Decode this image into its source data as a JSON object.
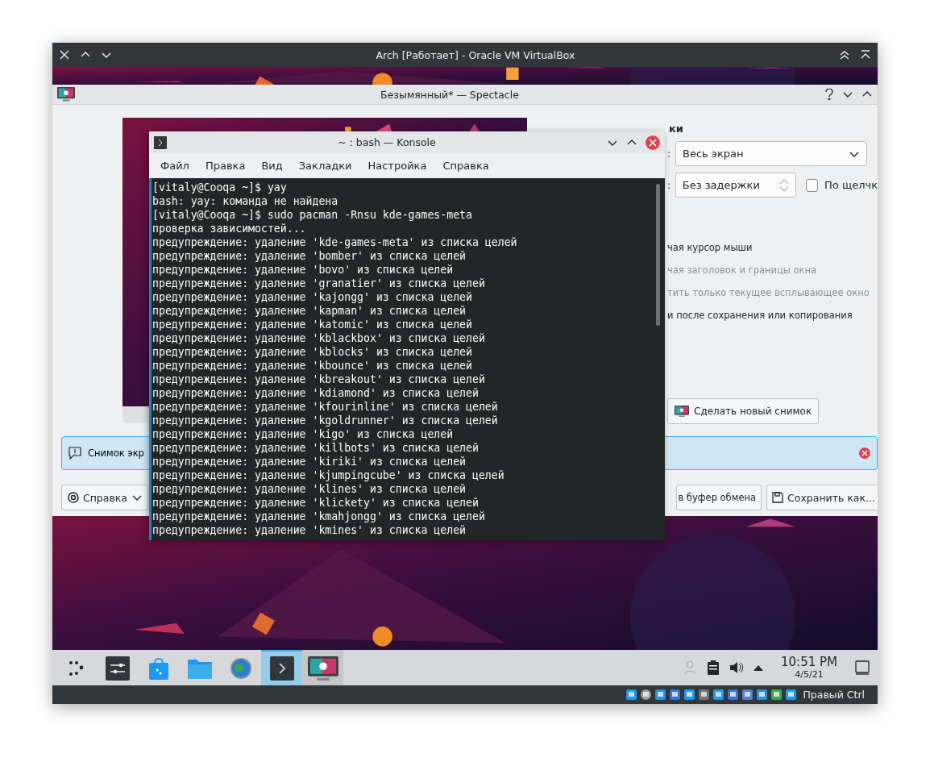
{
  "window": {
    "title": "Arch [Работает] - Oracle VM VirtualBox"
  },
  "spectacle": {
    "title": "Безымянный* — Spectacle",
    "heading": "ки",
    "area_label": ":",
    "area": "Весь экран",
    "delay_label": ":",
    "delay": "Без задержки",
    "on_click": {
      "label": "По щелчк",
      "checked": false
    },
    "options": [
      {
        "label": "чая курсор мыши",
        "disabled": false
      },
      {
        "label": "чая заголовок и границы окна",
        "disabled": true
      },
      {
        "label": "тить только текущее всплывающее окно",
        "disabled": true
      },
      {
        "label": "и после сохранения или копирования",
        "disabled": false
      }
    ],
    "new_button": "Сделать новый снимок",
    "banner": {
      "text": "Снимок экр"
    },
    "help_button": "Справка",
    "copy_button": "в буфер обмена",
    "save_button": "Сохранить как..."
  },
  "konsole": {
    "title": "~ : bash — Konsole",
    "menu": [
      "Файл",
      "Правка",
      "Вид",
      "Закладки",
      "Настройка",
      "Справка"
    ],
    "lines": [
      "[vitaly@Cooqa ~]$ yay",
      "bash: yay: команда не найдена",
      "[vitaly@Cooqa ~]$ sudo pacman -Rnsu kde-games-meta",
      "проверка зависимостей...",
      "предупреждение: удаление 'kde-games-meta' из списка целей",
      "предупреждение: удаление 'bomber' из списка целей",
      "предупреждение: удаление 'bovo' из списка целей",
      "предупреждение: удаление 'granatier' из списка целей",
      "предупреждение: удаление 'kajongg' из списка целей",
      "предупреждение: удаление 'kapman' из списка целей",
      "предупреждение: удаление 'katomic' из списка целей",
      "предупреждение: удаление 'kblackbox' из списка целей",
      "предупреждение: удаление 'kblocks' из списка целей",
      "предупреждение: удаление 'kbounce' из списка целей",
      "предупреждение: удаление 'kbreakout' из списка целей",
      "предупреждение: удаление 'kdiamond' из списка целей",
      "предупреждение: удаление 'kfourinline' из списка целей",
      "предупреждение: удаление 'kgoldrunner' из списка целей",
      "предупреждение: удаление 'kigo' из списка целей",
      "предупреждение: удаление 'killbots' из списка целей",
      "предупреждение: удаление 'kiriki' из списка целей",
      "предупреждение: удаление 'kjumpingcube' из списка целей",
      "предупреждение: удаление 'klines' из списка целей",
      "предупреждение: удаление 'klickety' из списка целей",
      "предупреждение: удаление 'kmahjongg' из списка целей",
      "предупреждение: удаление 'kmines' из списка целей"
    ]
  },
  "taskbar": {
    "apps": [
      {
        "kind": "launcher",
        "selected": false,
        "running": false
      },
      {
        "kind": "settings",
        "selected": false,
        "running": false
      },
      {
        "kind": "store",
        "selected": false,
        "running": false
      },
      {
        "kind": "files",
        "selected": false,
        "running": false
      },
      {
        "kind": "browser",
        "selected": false,
        "running": false
      },
      {
        "kind": "terminal",
        "selected": true,
        "running": true
      },
      {
        "kind": "screenshot",
        "selected": false,
        "running": true
      }
    ],
    "time": "10:51 PM",
    "date": "4/5/21"
  },
  "status_bar": {
    "host_key": "Правый Ctrl"
  }
}
